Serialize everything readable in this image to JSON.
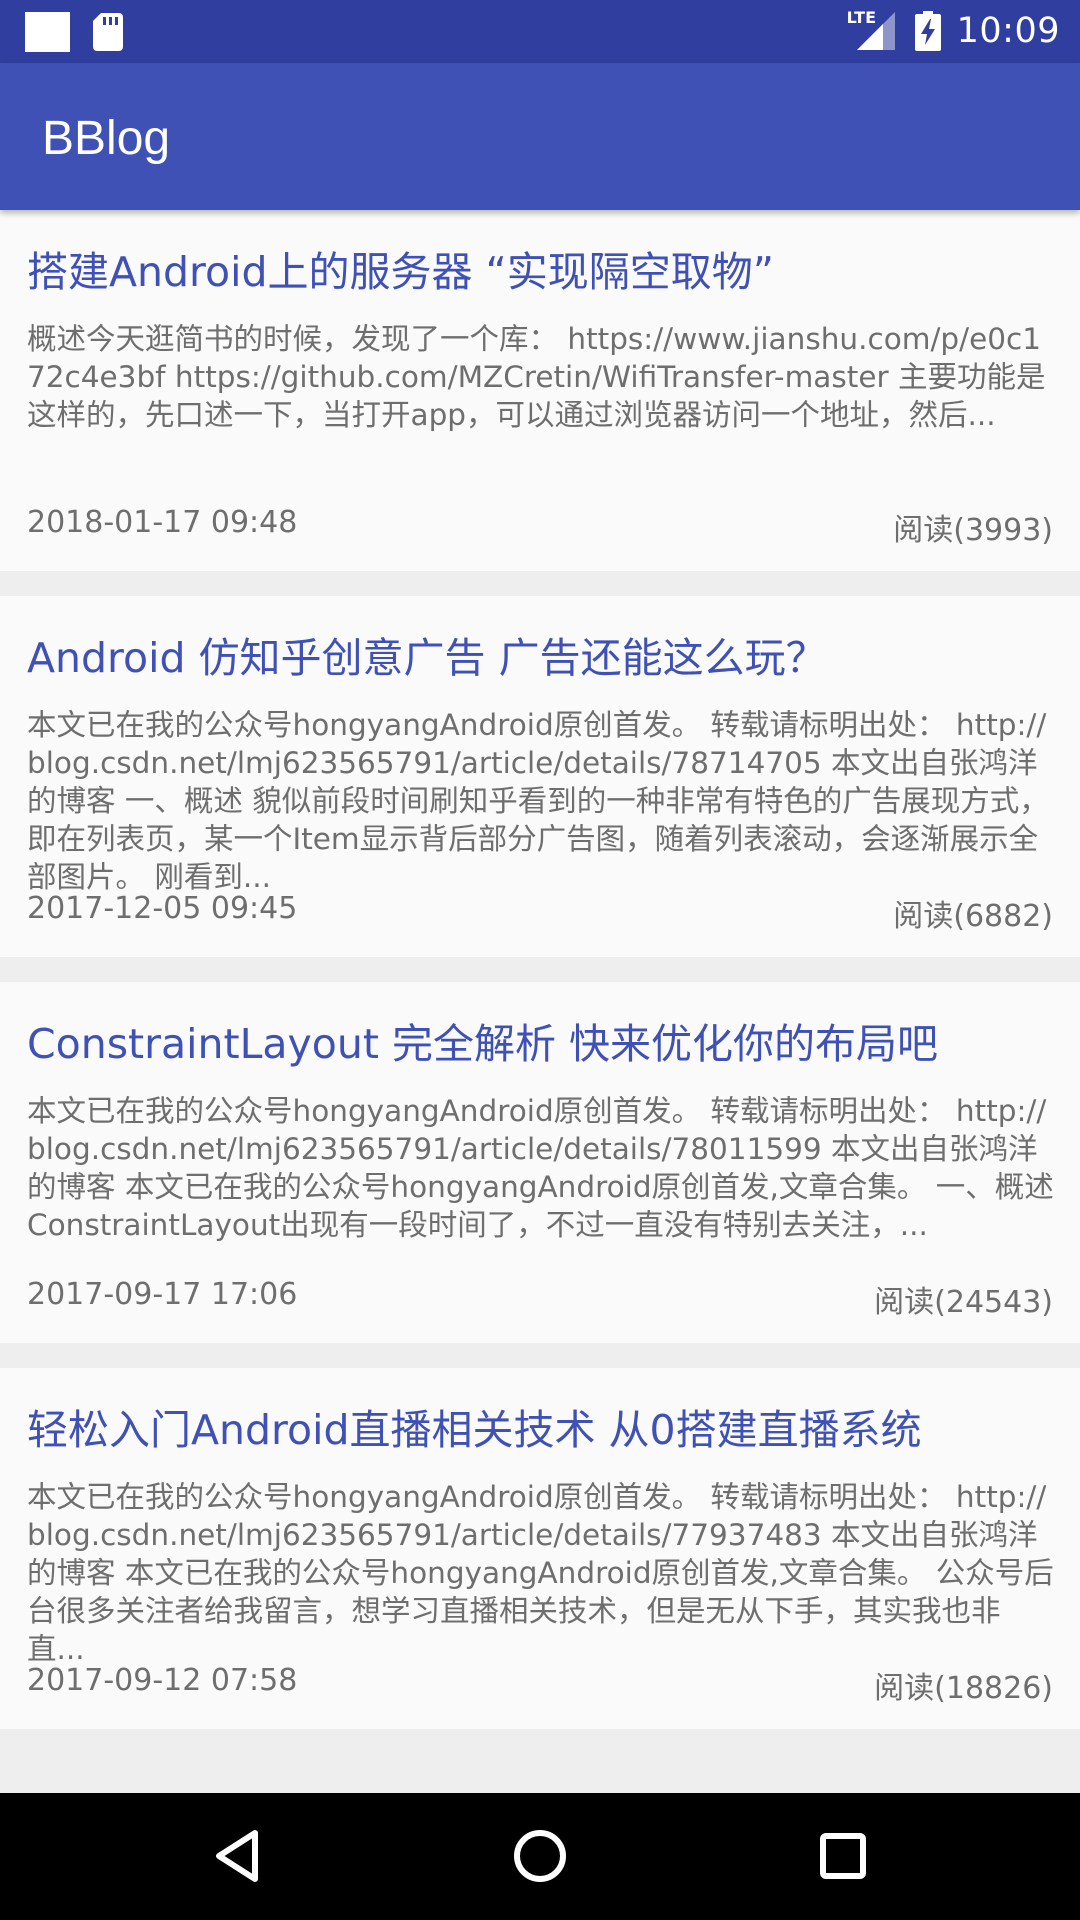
{
  "status_bar": {
    "time": "10:09",
    "network": "LTE",
    "icons": [
      "notification-square-icon",
      "sd-card-icon",
      "lte-signal-icon",
      "battery-charging-icon"
    ]
  },
  "app_bar": {
    "title": "BBlog"
  },
  "colors": {
    "primary": "#3f51b5",
    "primary_dark": "#303f9f",
    "title_text": "#3f51b5",
    "body_text": "#6e6e6e"
  },
  "articles": [
    {
      "title": "搭建Android上的服务器 “实现隔空取物”",
      "summary": "概述今天逛简书的时候，发现了一个库： https://www.jianshu.com/p/e0c172c4e3bf https://github.com/MZCretin/WifiTransfer-master 主要功能是这样的，先口述一下，当打开app，可以通过浏览器访问一个地址，然后...",
      "date": "2018-01-17 09:48",
      "reads": "阅读(3993)"
    },
    {
      "title": "Android 仿知乎创意广告 广告还能这么玩？",
      "summary": "本文已在我的公众号hongyangAndroid原创首发。 转载请标明出处： http://blog.csdn.net/lmj623565791/article/details/78714705 本文出自张鸿洋的博客 一、概述 貌似前段时间刷知乎看到的一种非常有特色的广告展现方式，即在列表页，某一个Item显示背后部分广告图，随着列表滚动，会逐渐展示全部图片。 刚看到...",
      "date": "2017-12-05 09:45",
      "reads": "阅读(6882)"
    },
    {
      "title": "ConstraintLayout 完全解析 快来优化你的布局吧",
      "summary": "本文已在我的公众号hongyangAndroid原创首发。 转载请标明出处： http://blog.csdn.net/lmj623565791/article/details/78011599 本文出自张鸿洋的博客 本文已在我的公众号hongyangAndroid原创首发,文章合集。 一、概述ConstraintLayout出现有一段时间了，不过一直没有特别去关注，...",
      "date": "2017-09-17 17:06",
      "reads": "阅读(24543)"
    },
    {
      "title": "轻松入门Android直播相关技术 从0搭建直播系统",
      "summary": "本文已在我的公众号hongyangAndroid原创首发。 转载请标明出处： http://blog.csdn.net/lmj623565791/article/details/77937483 本文出自张鸿洋的博客 本文已在我的公众号hongyangAndroid原创首发,文章合集。 公众号后台很多关注者给我留言，想学习直播相关技术，但是无从下手，其实我也非直...",
      "date": "2017-09-12 07:58",
      "reads": "阅读(18826)"
    }
  ],
  "nav_bar": {
    "buttons": [
      "back-icon",
      "home-icon",
      "recents-icon"
    ]
  }
}
